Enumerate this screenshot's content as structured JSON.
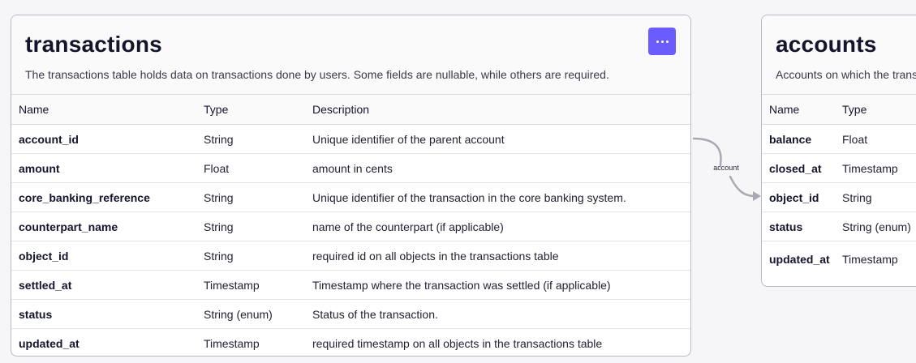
{
  "tables": [
    {
      "title": "transactions",
      "description": "The transactions table holds data on transactions done by users. Some fields are nullable, while others are required.",
      "menu_icon": "more-horizontal-icon",
      "columns": [
        "Name",
        "Type",
        "Description"
      ],
      "rows": [
        {
          "name": "account_id",
          "type": "String",
          "description": "Unique identifier of the parent account"
        },
        {
          "name": "amount",
          "type": "Float",
          "description": "amount in cents"
        },
        {
          "name": "core_banking_reference",
          "type": "String",
          "description": "Unique identifier of the transaction in the core banking system."
        },
        {
          "name": "counterpart_name",
          "type": "String",
          "description": "name of the counterpart (if applicable)"
        },
        {
          "name": "object_id",
          "type": "String",
          "description": "required id on all objects in the transactions table"
        },
        {
          "name": "settled_at",
          "type": "Timestamp",
          "description": "Timestamp where the transaction was settled (if applicable)"
        },
        {
          "name": "status",
          "type": "String (enum)",
          "description": "Status of the transaction."
        },
        {
          "name": "updated_at",
          "type": "Timestamp",
          "description": "required timestamp on all objects in the transactions table"
        }
      ]
    },
    {
      "title": "accounts",
      "description": "Accounts on which the transactions are done.",
      "columns": [
        "Name",
        "Type"
      ],
      "rows": [
        {
          "name": "balance",
          "type": "Float"
        },
        {
          "name": "closed_at",
          "type": "Timestamp"
        },
        {
          "name": "object_id",
          "type": "String"
        },
        {
          "name": "status",
          "type": "String (enum)"
        },
        {
          "name": "updated_at",
          "type": "Timestamp"
        }
      ]
    }
  ],
  "relation": {
    "label": "account",
    "from": "transactions",
    "to": "accounts",
    "color": "#a9a9b3"
  },
  "colors": {
    "accent": "#6a5cff",
    "background": "#f6f6f8",
    "card_border": "#b9b9c4",
    "text": "#14142b"
  }
}
